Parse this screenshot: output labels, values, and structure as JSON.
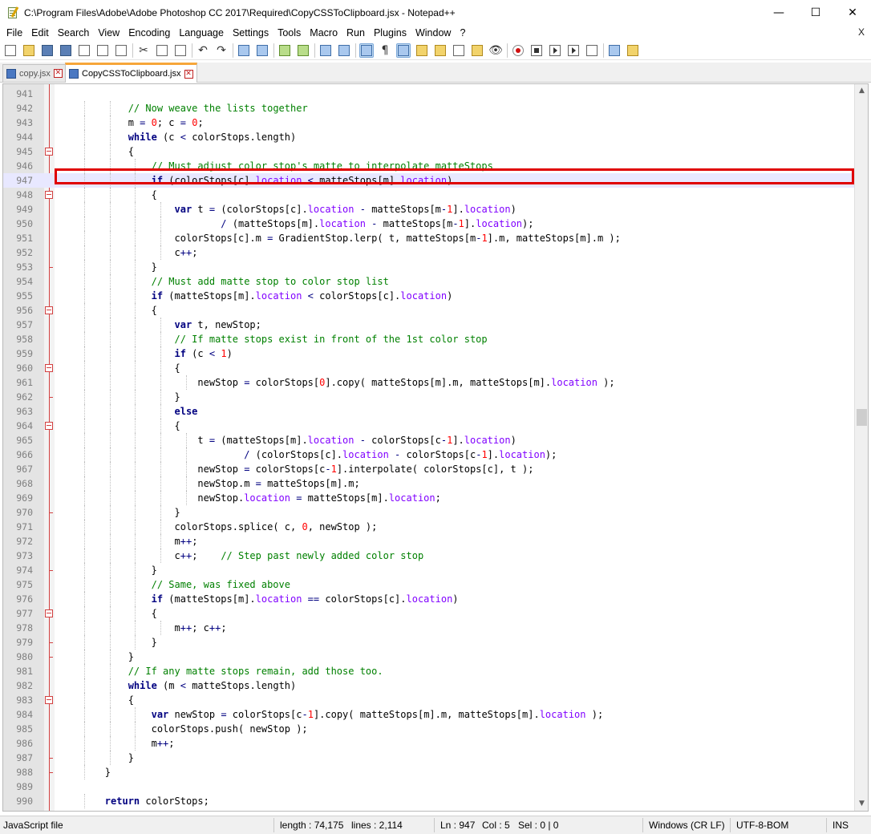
{
  "window": {
    "title": "C:\\Program Files\\Adobe\\Adobe Photoshop CC 2017\\Required\\CopyCSSToClipboard.jsx - Notepad++",
    "minimize_glyph": "—",
    "maximize_glyph": "☐",
    "close_glyph": "✕"
  },
  "menu": {
    "items": [
      "File",
      "Edit",
      "Search",
      "View",
      "Encoding",
      "Language",
      "Settings",
      "Tools",
      "Macro",
      "Run",
      "Plugins",
      "Window",
      "?"
    ],
    "close_doc": "X"
  },
  "toolbar": {
    "icons": [
      "new-file-icon",
      "open-file-icon",
      "save-icon",
      "save-all-icon",
      "close-icon",
      "close-all-icon",
      "print-icon",
      "cut-icon",
      "copy-icon",
      "paste-icon",
      "undo-icon",
      "redo-icon",
      "find-icon",
      "replace-icon",
      "zoom-in-icon",
      "zoom-out-icon",
      "sync-vertical-icon",
      "sync-horizontal-icon",
      "word-wrap-icon",
      "show-all-chars-icon",
      "indent-guide-icon",
      "user-lang-icon",
      "doc-map-icon",
      "function-list-icon",
      "folder-workspace-icon",
      "monitoring-icon",
      "record-macro-icon",
      "stop-record-icon",
      "play-macro-icon",
      "run-macro-multiple-icon",
      "save-macro-icon",
      "spellcheck-icon",
      "plugin-icon"
    ]
  },
  "tabs": [
    {
      "label": "copy.jsx",
      "active": false
    },
    {
      "label": "CopyCSSToClipboard.jsx",
      "active": true
    }
  ],
  "editor": {
    "highlighted_line": 947,
    "lines": [
      {
        "n": "941",
        "indent": 0,
        "parts": []
      },
      {
        "n": "942",
        "indent": 3,
        "parts": [
          [
            "cm",
            "// Now weave the lists together"
          ]
        ]
      },
      {
        "n": "943",
        "indent": 3,
        "parts": [
          [
            "",
            "m "
          ],
          [
            "op",
            "="
          ],
          [
            "",
            " "
          ],
          [
            "num",
            "0"
          ],
          [
            "",
            "; c "
          ],
          [
            "op",
            "="
          ],
          [
            "",
            " "
          ],
          [
            "num",
            "0"
          ],
          [
            "",
            ";"
          ]
        ]
      },
      {
        "n": "944",
        "indent": 3,
        "parts": [
          [
            "kw",
            "while"
          ],
          [
            "",
            " (c "
          ],
          [
            "op",
            "<"
          ],
          [
            "",
            " colorStops.length)"
          ]
        ]
      },
      {
        "n": "945",
        "indent": 3,
        "fold": "open",
        "parts": [
          [
            "",
            "{"
          ]
        ]
      },
      {
        "n": "946",
        "indent": 4,
        "parts": [
          [
            "cm",
            "// Must adjust color stop's matte to interpolate matteStops"
          ]
        ]
      },
      {
        "n": "947",
        "indent": 4,
        "parts": [
          [
            "kw",
            "if"
          ],
          [
            "",
            " (colorStops[c]."
          ],
          [
            "prop",
            "location"
          ],
          [
            "",
            " "
          ],
          [
            "op",
            "<"
          ],
          [
            "",
            " matteStops[m]."
          ],
          [
            "prop",
            "location"
          ],
          [
            "",
            ")"
          ]
        ]
      },
      {
        "n": "948",
        "indent": 4,
        "fold": "open",
        "parts": [
          [
            "",
            "{"
          ]
        ]
      },
      {
        "n": "949",
        "indent": 5,
        "parts": [
          [
            "kw",
            "var"
          ],
          [
            "",
            " t "
          ],
          [
            "op",
            "="
          ],
          [
            "",
            " (colorStops[c]."
          ],
          [
            "prop",
            "location"
          ],
          [
            "",
            " "
          ],
          [
            "op",
            "-"
          ],
          [
            "",
            " matteStops[m"
          ],
          [
            "op",
            "-"
          ],
          [
            "num",
            "1"
          ],
          [
            "",
            "]."
          ],
          [
            "prop",
            "location"
          ],
          [
            "",
            ")"
          ]
        ]
      },
      {
        "n": "950",
        "indent": 5,
        "pre": "        ",
        "parts": [
          [
            "op",
            "/"
          ],
          [
            "",
            " (matteStops[m]."
          ],
          [
            "prop",
            "location"
          ],
          [
            "",
            " "
          ],
          [
            "op",
            "-"
          ],
          [
            "",
            " matteStops[m"
          ],
          [
            "op",
            "-"
          ],
          [
            "num",
            "1"
          ],
          [
            "",
            "]."
          ],
          [
            "prop",
            "location"
          ],
          [
            "",
            ");"
          ]
        ]
      },
      {
        "n": "951",
        "indent": 5,
        "parts": [
          [
            "",
            "colorStops[c].m "
          ],
          [
            "op",
            "="
          ],
          [
            "",
            " GradientStop.lerp( t, matteStops[m"
          ],
          [
            "op",
            "-"
          ],
          [
            "num",
            "1"
          ],
          [
            "",
            "].m, matteStops[m].m );"
          ]
        ]
      },
      {
        "n": "952",
        "indent": 5,
        "parts": [
          [
            "",
            "c"
          ],
          [
            "op",
            "++"
          ],
          [
            "",
            ";"
          ]
        ]
      },
      {
        "n": "953",
        "indent": 4,
        "fold": "end",
        "parts": [
          [
            "",
            "}"
          ]
        ]
      },
      {
        "n": "954",
        "indent": 4,
        "parts": [
          [
            "cm",
            "// Must add matte stop to color stop list"
          ]
        ]
      },
      {
        "n": "955",
        "indent": 4,
        "parts": [
          [
            "kw",
            "if"
          ],
          [
            "",
            " (matteStops[m]."
          ],
          [
            "prop",
            "location"
          ],
          [
            "",
            " "
          ],
          [
            "op",
            "<"
          ],
          [
            "",
            " colorStops[c]."
          ],
          [
            "prop",
            "location"
          ],
          [
            "",
            ")"
          ]
        ]
      },
      {
        "n": "956",
        "indent": 4,
        "fold": "open",
        "parts": [
          [
            "",
            "{"
          ]
        ]
      },
      {
        "n": "957",
        "indent": 5,
        "parts": [
          [
            "kw",
            "var"
          ],
          [
            "",
            " t, newStop;"
          ]
        ]
      },
      {
        "n": "958",
        "indent": 5,
        "parts": [
          [
            "cm",
            "// If matte stops exist in front of the 1st color stop"
          ]
        ]
      },
      {
        "n": "959",
        "indent": 5,
        "parts": [
          [
            "kw",
            "if"
          ],
          [
            "",
            " (c "
          ],
          [
            "op",
            "<"
          ],
          [
            "",
            " "
          ],
          [
            "num",
            "1"
          ],
          [
            "",
            ")"
          ]
        ]
      },
      {
        "n": "960",
        "indent": 5,
        "fold": "open",
        "parts": [
          [
            "",
            "{"
          ]
        ]
      },
      {
        "n": "961",
        "indent": 6,
        "parts": [
          [
            "",
            "newStop "
          ],
          [
            "op",
            "="
          ],
          [
            "",
            " colorStops["
          ],
          [
            "num",
            "0"
          ],
          [
            "",
            "].copy( matteStops[m].m, matteStops[m]."
          ],
          [
            "prop",
            "location"
          ],
          [
            "",
            " );"
          ]
        ]
      },
      {
        "n": "962",
        "indent": 5,
        "fold": "end",
        "parts": [
          [
            "",
            "}"
          ]
        ]
      },
      {
        "n": "963",
        "indent": 5,
        "parts": [
          [
            "kw",
            "else"
          ]
        ]
      },
      {
        "n": "964",
        "indent": 5,
        "fold": "open",
        "parts": [
          [
            "",
            "{"
          ]
        ]
      },
      {
        "n": "965",
        "indent": 6,
        "parts": [
          [
            "",
            "t "
          ],
          [
            "op",
            "="
          ],
          [
            "",
            " (matteStops[m]."
          ],
          [
            "prop",
            "location"
          ],
          [
            "",
            " "
          ],
          [
            "op",
            "-"
          ],
          [
            "",
            " colorStops[c"
          ],
          [
            "op",
            "-"
          ],
          [
            "num",
            "1"
          ],
          [
            "",
            "]."
          ],
          [
            "prop",
            "location"
          ],
          [
            "",
            ")"
          ]
        ]
      },
      {
        "n": "966",
        "indent": 6,
        "pre": "        ",
        "parts": [
          [
            "op",
            "/"
          ],
          [
            "",
            " (colorStops[c]."
          ],
          [
            "prop",
            "location"
          ],
          [
            "",
            " "
          ],
          [
            "op",
            "-"
          ],
          [
            "",
            " colorStops[c"
          ],
          [
            "op",
            "-"
          ],
          [
            "num",
            "1"
          ],
          [
            "",
            "]."
          ],
          [
            "prop",
            "location"
          ],
          [
            "",
            ");"
          ]
        ]
      },
      {
        "n": "967",
        "indent": 6,
        "parts": [
          [
            "",
            "newStop "
          ],
          [
            "op",
            "="
          ],
          [
            "",
            " colorStops[c"
          ],
          [
            "op",
            "-"
          ],
          [
            "num",
            "1"
          ],
          [
            "",
            "].interpolate( colorStops[c], t );"
          ]
        ]
      },
      {
        "n": "968",
        "indent": 6,
        "parts": [
          [
            "",
            "newStop.m "
          ],
          [
            "op",
            "="
          ],
          [
            "",
            " matteStops[m].m;"
          ]
        ]
      },
      {
        "n": "969",
        "indent": 6,
        "parts": [
          [
            "",
            "newStop."
          ],
          [
            "prop",
            "location"
          ],
          [
            "",
            " "
          ],
          [
            "op",
            "="
          ],
          [
            "",
            " matteStops[m]."
          ],
          [
            "prop",
            "location"
          ],
          [
            "",
            ";"
          ]
        ]
      },
      {
        "n": "970",
        "indent": 5,
        "fold": "end",
        "parts": [
          [
            "",
            "}"
          ]
        ]
      },
      {
        "n": "971",
        "indent": 5,
        "parts": [
          [
            "",
            "colorStops.splice( c, "
          ],
          [
            "num",
            "0"
          ],
          [
            "",
            ", newStop );"
          ]
        ]
      },
      {
        "n": "972",
        "indent": 5,
        "parts": [
          [
            "",
            "m"
          ],
          [
            "op",
            "++"
          ],
          [
            "",
            ";"
          ]
        ]
      },
      {
        "n": "973",
        "indent": 5,
        "parts": [
          [
            "",
            "c"
          ],
          [
            "op",
            "++"
          ],
          [
            "",
            ";    "
          ],
          [
            "cm",
            "// Step past newly added color stop"
          ]
        ]
      },
      {
        "n": "974",
        "indent": 4,
        "fold": "end",
        "parts": [
          [
            "",
            "}"
          ]
        ]
      },
      {
        "n": "975",
        "indent": 4,
        "parts": [
          [
            "cm",
            "// Same, was fixed above"
          ]
        ]
      },
      {
        "n": "976",
        "indent": 4,
        "parts": [
          [
            "kw",
            "if"
          ],
          [
            "",
            " (matteStops[m]."
          ],
          [
            "prop",
            "location"
          ],
          [
            "",
            " "
          ],
          [
            "op",
            "=="
          ],
          [
            "",
            " colorStops[c]."
          ],
          [
            "prop",
            "location"
          ],
          [
            "",
            ")"
          ]
        ]
      },
      {
        "n": "977",
        "indent": 4,
        "fold": "open",
        "parts": [
          [
            "",
            "{"
          ]
        ]
      },
      {
        "n": "978",
        "indent": 5,
        "parts": [
          [
            "",
            "m"
          ],
          [
            "op",
            "++"
          ],
          [
            "",
            "; c"
          ],
          [
            "op",
            "++"
          ],
          [
            "",
            ";"
          ]
        ]
      },
      {
        "n": "979",
        "indent": 4,
        "fold": "end",
        "parts": [
          [
            "",
            "}"
          ]
        ]
      },
      {
        "n": "980",
        "indent": 3,
        "fold": "end",
        "parts": [
          [
            "",
            "}"
          ]
        ]
      },
      {
        "n": "981",
        "indent": 3,
        "parts": [
          [
            "cm",
            "// If any matte stops remain, add those too."
          ]
        ]
      },
      {
        "n": "982",
        "indent": 3,
        "parts": [
          [
            "kw",
            "while"
          ],
          [
            "",
            " (m "
          ],
          [
            "op",
            "<"
          ],
          [
            "",
            " matteStops.length)"
          ]
        ]
      },
      {
        "n": "983",
        "indent": 3,
        "fold": "open",
        "parts": [
          [
            "",
            "{"
          ]
        ]
      },
      {
        "n": "984",
        "indent": 4,
        "parts": [
          [
            "kw",
            "var"
          ],
          [
            "",
            " newStop "
          ],
          [
            "op",
            "="
          ],
          [
            "",
            " colorStops[c"
          ],
          [
            "op",
            "-"
          ],
          [
            "num",
            "1"
          ],
          [
            "",
            "].copy( matteStops[m].m, matteStops[m]."
          ],
          [
            "prop",
            "location"
          ],
          [
            "",
            " );"
          ]
        ]
      },
      {
        "n": "985",
        "indent": 4,
        "parts": [
          [
            "",
            "colorStops.push( newStop );"
          ]
        ]
      },
      {
        "n": "986",
        "indent": 4,
        "parts": [
          [
            "",
            "m"
          ],
          [
            "op",
            "++"
          ],
          [
            "",
            ";"
          ]
        ]
      },
      {
        "n": "987",
        "indent": 3,
        "fold": "end",
        "parts": [
          [
            "",
            "}"
          ]
        ]
      },
      {
        "n": "988",
        "indent": 2,
        "fold": "end",
        "parts": [
          [
            "",
            "}"
          ]
        ]
      },
      {
        "n": "989",
        "indent": 0,
        "parts": []
      },
      {
        "n": "990",
        "indent": 2,
        "parts": [
          [
            "kw",
            "return"
          ],
          [
            "",
            " colorStops;"
          ]
        ]
      }
    ]
  },
  "status": {
    "file_type": "JavaScript file",
    "length": "length : 74,175",
    "lines": "lines : 2,114",
    "ln": "Ln : 947",
    "col": "Col : 5",
    "sel": "Sel : 0 | 0",
    "eol": "Windows (CR LF)",
    "encoding": "UTF-8-BOM",
    "mode": "INS"
  }
}
